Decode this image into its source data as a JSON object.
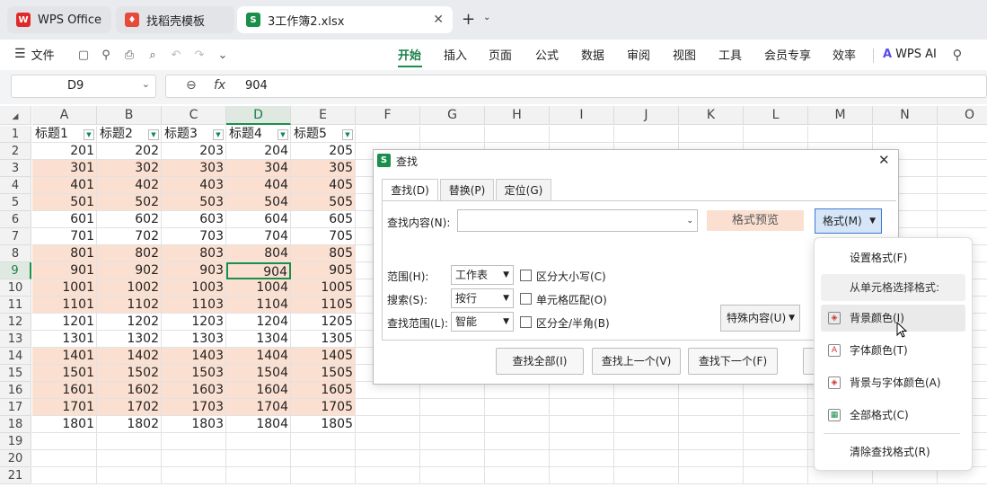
{
  "tabs": [
    {
      "label": "WPS Office",
      "icon": "wps-logo-icon"
    },
    {
      "label": "找稻壳模板",
      "icon": "docer-icon"
    },
    {
      "label": "3工作簿2.xlsx",
      "icon": "spreadsheet-icon"
    }
  ],
  "menu": {
    "file_label": "文件",
    "items": [
      "开始",
      "插入",
      "页面",
      "公式",
      "数据",
      "审阅",
      "视图",
      "工具",
      "会员专享",
      "效率"
    ],
    "ai_label": "WPS AI"
  },
  "formula": {
    "cell_ref": "D9",
    "fx": "fx",
    "value": "904"
  },
  "grid": {
    "col_letters": [
      "A",
      "B",
      "C",
      "D",
      "E",
      "F",
      "G",
      "H",
      "I",
      "J",
      "K",
      "L",
      "M",
      "N",
      "O"
    ],
    "header_row": [
      "标题1",
      "标题2",
      "标题3",
      "标题4",
      "标题5"
    ],
    "rows": [
      [
        "201",
        "202",
        "203",
        "204",
        "205"
      ],
      [
        "301",
        "302",
        "303",
        "304",
        "305"
      ],
      [
        "401",
        "402",
        "403",
        "404",
        "405"
      ],
      [
        "501",
        "502",
        "503",
        "504",
        "505"
      ],
      [
        "601",
        "602",
        "603",
        "604",
        "605"
      ],
      [
        "701",
        "702",
        "703",
        "704",
        "705"
      ],
      [
        "801",
        "802",
        "803",
        "804",
        "805"
      ],
      [
        "901",
        "902",
        "903",
        "904",
        "905"
      ],
      [
        "1001",
        "1002",
        "1003",
        "1004",
        "1005"
      ],
      [
        "1101",
        "1102",
        "1103",
        "1104",
        "1105"
      ],
      [
        "1201",
        "1202",
        "1203",
        "1204",
        "1205"
      ],
      [
        "1301",
        "1302",
        "1303",
        "1304",
        "1305"
      ],
      [
        "1401",
        "1402",
        "1403",
        "1404",
        "1405"
      ],
      [
        "1501",
        "1502",
        "1503",
        "1504",
        "1505"
      ],
      [
        "1601",
        "1602",
        "1603",
        "1604",
        "1605"
      ],
      [
        "1701",
        "1702",
        "1703",
        "1704",
        "1705"
      ],
      [
        "1801",
        "1802",
        "1803",
        "1804",
        "1805"
      ]
    ],
    "highlighted_rows": [
      3,
      4,
      5,
      8,
      9,
      10,
      11,
      14,
      15,
      16,
      17
    ],
    "row_count": 21,
    "highlight_color": "#fbe0d2",
    "selected_cell": "D9"
  },
  "dialog": {
    "title": "查找",
    "tabs": [
      "查找(D)",
      "替换(P)",
      "定位(G)"
    ],
    "find_label": "查找内容(N):",
    "find_value": "",
    "preview_label": "格式预览",
    "format_btn": "格式(M)",
    "scope_label": "范围(H):",
    "scope_value": "工作表",
    "search_label": "搜索(S):",
    "search_value": "按行",
    "lookin_label": "查找范围(L):",
    "lookin_value": "智能",
    "opt_case": "区分大小写(C)",
    "opt_whole": "单元格匹配(O)",
    "opt_width": "区分全/半角(B)",
    "special_btn": "特殊内容(U)",
    "find_all": "查找全部(I)",
    "find_prev": "查找上一个(V)",
    "find_next": "查找下一个(F)"
  },
  "popup": {
    "items": [
      {
        "label": "设置格式(F)",
        "icon": ""
      },
      {
        "label": "从单元格选择格式:",
        "icon": ""
      },
      {
        "label": "背景颜色(I)",
        "icon": "bg-color-icon"
      },
      {
        "label": "字体颜色(T)",
        "icon": "font-color-icon"
      },
      {
        "label": "背景与字体颜色(A)",
        "icon": "bg-font-color-icon"
      },
      {
        "label": "全部格式(C)",
        "icon": "all-format-icon"
      },
      {
        "label": "清除查找格式(R)",
        "icon": ""
      }
    ]
  }
}
